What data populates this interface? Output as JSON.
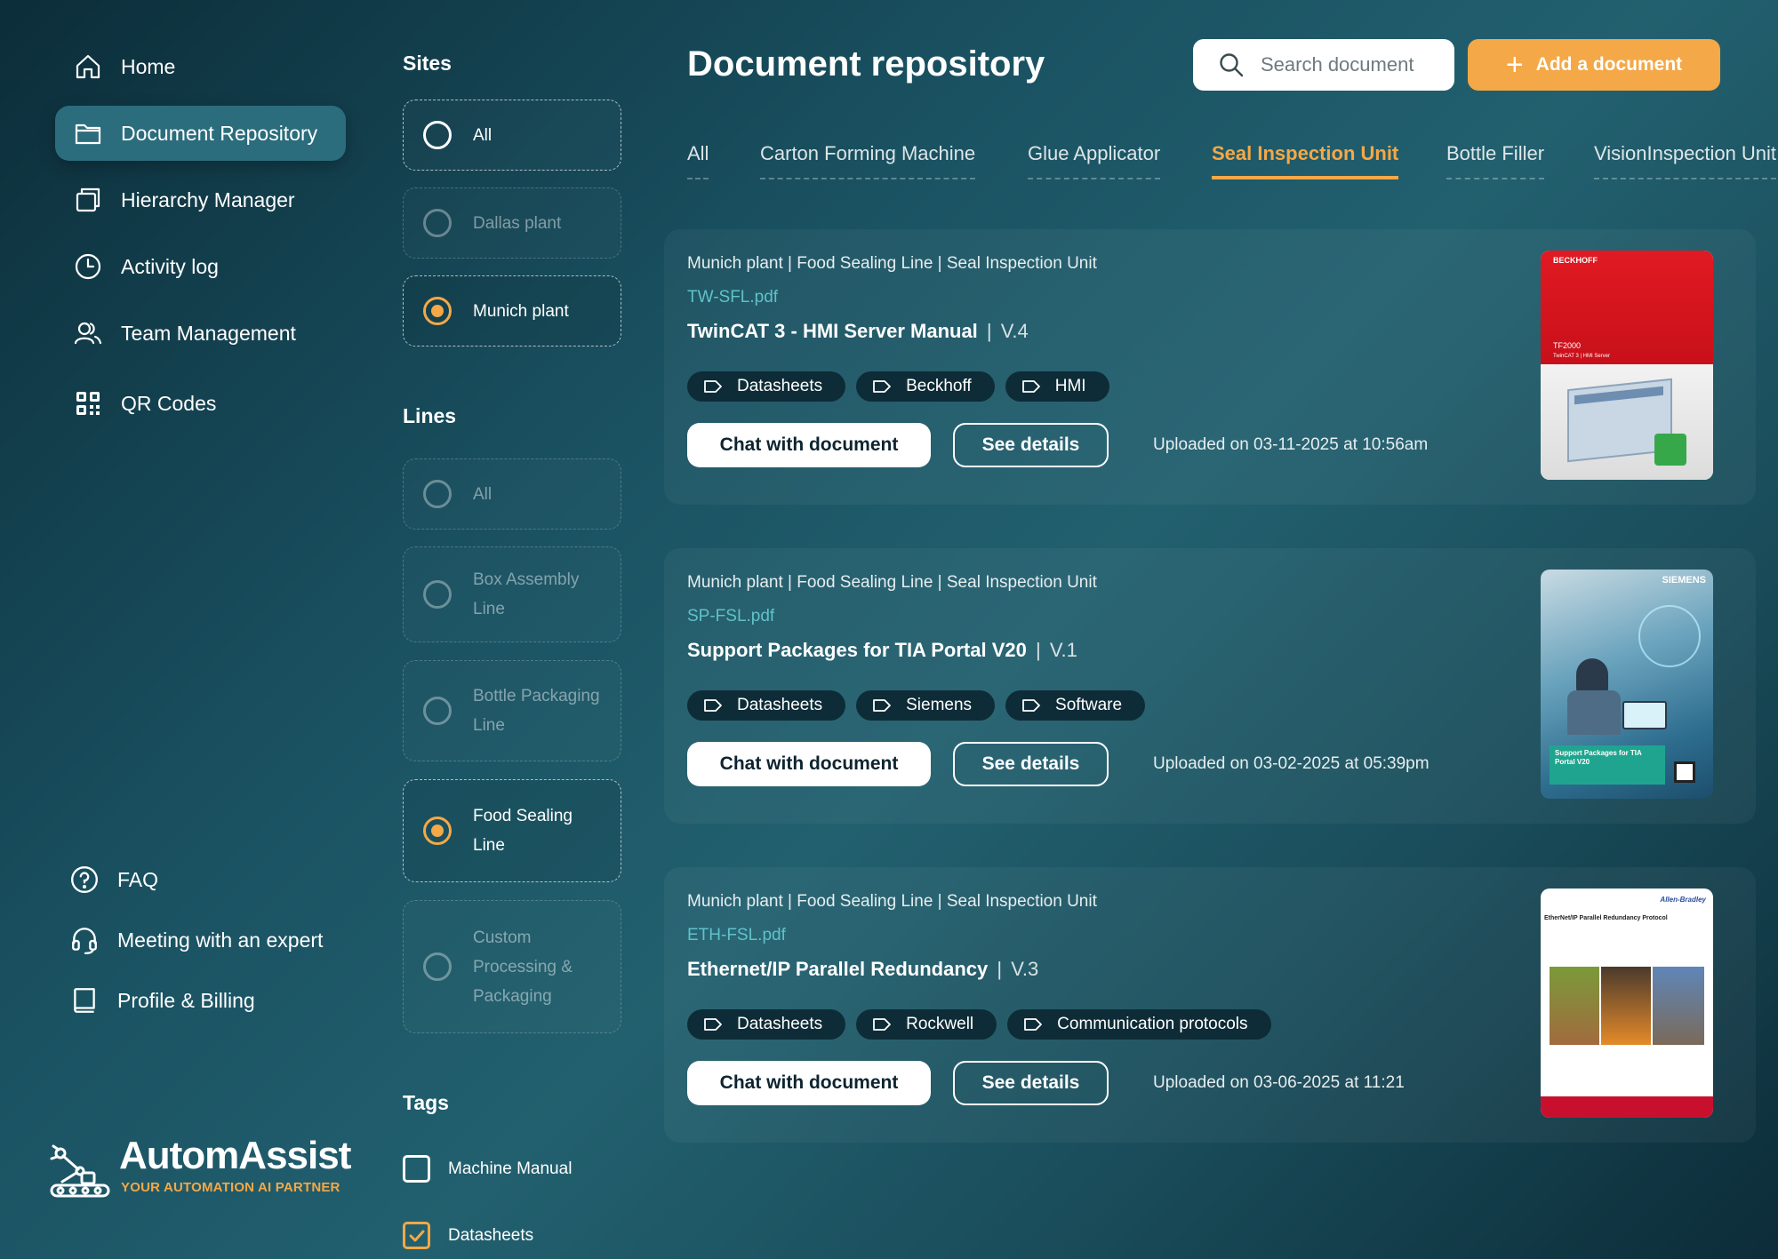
{
  "sidebar": {
    "items": [
      {
        "label": "Home",
        "icon": "home-icon"
      },
      {
        "label": "Document Repository",
        "icon": "folder-icon"
      },
      {
        "label": "Hierarchy Manager",
        "icon": "hierarchy-icon"
      },
      {
        "label": "Activity log",
        "icon": "clock-icon"
      },
      {
        "label": "Team Management",
        "icon": "team-icon"
      },
      {
        "label": "QR Codes",
        "icon": "qr-icon"
      }
    ],
    "bottom": [
      {
        "label": "FAQ",
        "icon": "help-icon"
      },
      {
        "label": "Meeting with an expert",
        "icon": "headset-icon"
      },
      {
        "label": "Profile & Billing",
        "icon": "book-icon"
      }
    ],
    "logo": {
      "name": "AutomAssist",
      "tagline": "YOUR AUTOMATION AI PARTNER"
    }
  },
  "filters": {
    "sites_title": "Sites",
    "sites": [
      {
        "label": "All",
        "selected": false
      },
      {
        "label": "Dallas plant",
        "selected": false
      },
      {
        "label": "Munich plant",
        "selected": true
      }
    ],
    "lines_title": "Lines",
    "lines": [
      {
        "label": "All",
        "selected": false
      },
      {
        "label": "Box Assembly Line",
        "selected": false
      },
      {
        "label": "Bottle Packaging Line",
        "selected": false
      },
      {
        "label": "Food Sealing Line",
        "selected": true
      },
      {
        "label": "Custom Processing & Packaging",
        "selected": false
      }
    ],
    "tags_title": "Tags",
    "tags": [
      {
        "label": "Machine Manual",
        "checked": false
      },
      {
        "label": "Datasheets",
        "checked": true
      }
    ]
  },
  "main": {
    "title": "Document repository",
    "search_placeholder": "Search document",
    "add_label": "Add a document",
    "tabs": [
      "All",
      "Carton Forming Machine",
      "Glue Applicator",
      "Seal Inspection Unit",
      "Bottle Filler",
      "VisionInspection Unit"
    ],
    "active_tab": "Seal Inspection Unit",
    "chat_label": "Chat with document",
    "details_label": "See details",
    "documents": [
      {
        "path": "Munich plant | Food Sealing Line | Seal Inspection Unit",
        "file": "TW-SFL.pdf",
        "title": "TwinCAT 3 - HMI Server Manual",
        "version": "V.4",
        "tags": [
          "Datasheets",
          "Beckhoff",
          "HMI"
        ],
        "uploaded": "Uploaded on 03-11-2025 at 10:56am",
        "cover": {
          "brand": "BECKHOFF",
          "code": "TF2000",
          "subtitle": "TwinCAT 3 | HMI Server"
        }
      },
      {
        "path": "Munich plant | Food Sealing Line | Seal Inspection Unit",
        "file": "SP-FSL.pdf",
        "title": "Support Packages for TIA Portal V20",
        "version": "V.1",
        "tags": [
          "Datasheets",
          "Siemens",
          "Software"
        ],
        "uploaded": "Uploaded on 03-02-2025 at 05:39pm",
        "cover": {
          "brand": "SIEMENS",
          "caption": "Support Packages for TIA Portal V20"
        }
      },
      {
        "path": "Munich plant | Food Sealing Line | Seal Inspection Unit",
        "file": "ETH-FSL.pdf",
        "title": "Ethernet/IP Parallel Redundancy",
        "version": "V.3",
        "tags": [
          "Datasheets",
          "Rockwell",
          "Communication protocols"
        ],
        "uploaded": "Uploaded on 03-06-2025 at 11:21",
        "cover": {
          "brand": "Allen-Bradley",
          "heading": "EtherNet/IP Parallel Redundancy Protocol"
        }
      }
    ]
  }
}
